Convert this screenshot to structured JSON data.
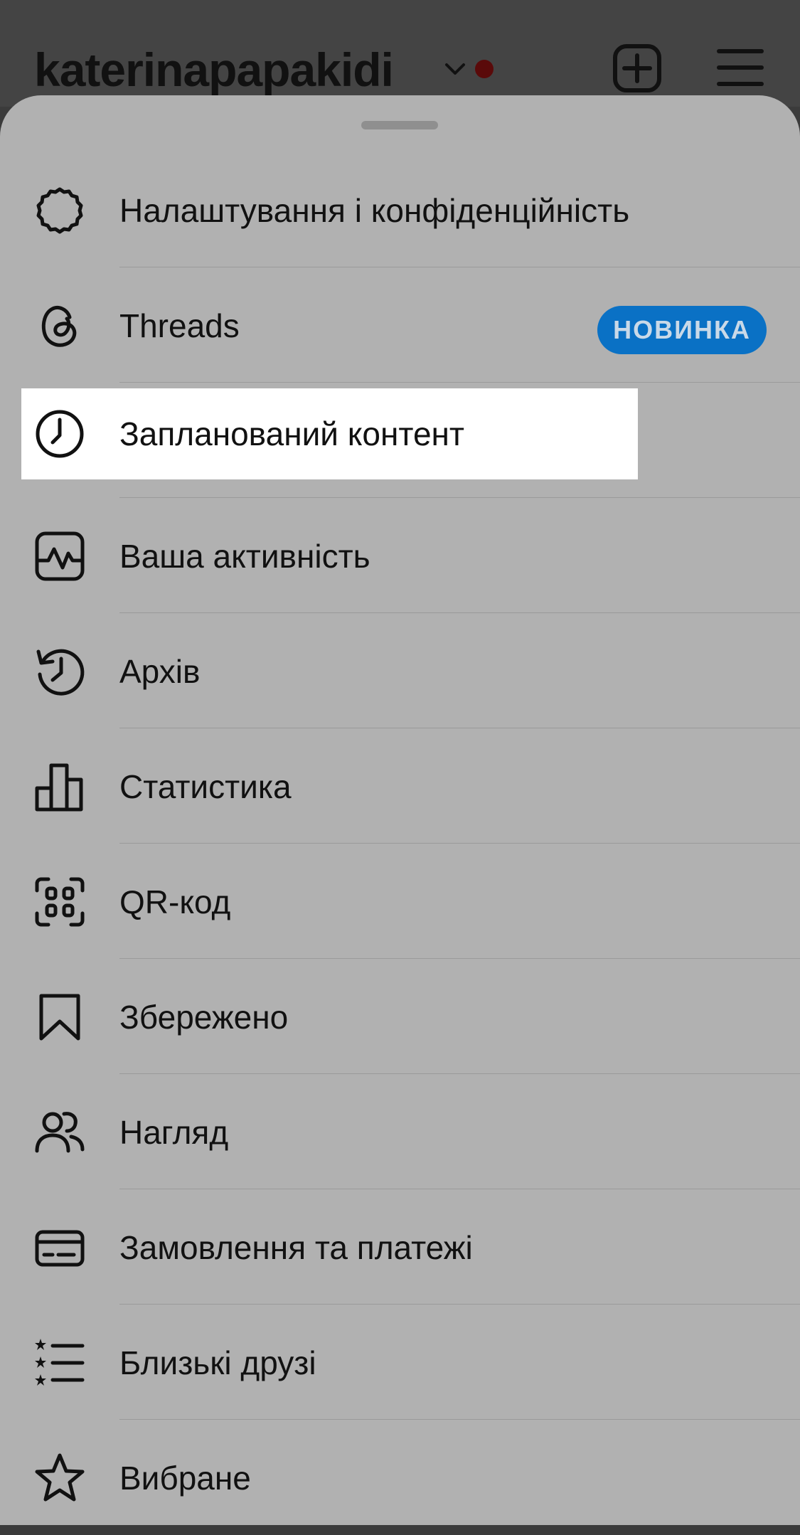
{
  "header": {
    "username": "katerinapapakidi",
    "icons": [
      "chevron-down-icon",
      "notification-dot",
      "add-post-icon",
      "hamburger-menu-icon"
    ]
  },
  "menu": {
    "items": [
      {
        "label": "Налаштування і конфіденційність",
        "icon": "settings-icon"
      },
      {
        "label": "Threads",
        "icon": "threads-icon",
        "badge": "НОВИНКА"
      },
      {
        "label": "Запланований контент",
        "icon": "clock-icon",
        "highlighted": true
      },
      {
        "label": "Ваша активність",
        "icon": "activity-icon"
      },
      {
        "label": "Архів",
        "icon": "archive-icon"
      },
      {
        "label": "Статистика",
        "icon": "insights-icon"
      },
      {
        "label": "QR-код",
        "icon": "qr-code-icon"
      },
      {
        "label": "Збережено",
        "icon": "bookmark-icon"
      },
      {
        "label": "Нагляд",
        "icon": "supervision-icon"
      },
      {
        "label": "Замовлення та платежі",
        "icon": "card-icon"
      },
      {
        "label": "Близькі друзі",
        "icon": "close-friends-icon"
      },
      {
        "label": "Вибране",
        "icon": "star-icon"
      }
    ]
  },
  "colors": {
    "badge": "#0a71c5",
    "overlay_sheet": "#b1b1b1",
    "highlight": "#ffffff"
  }
}
